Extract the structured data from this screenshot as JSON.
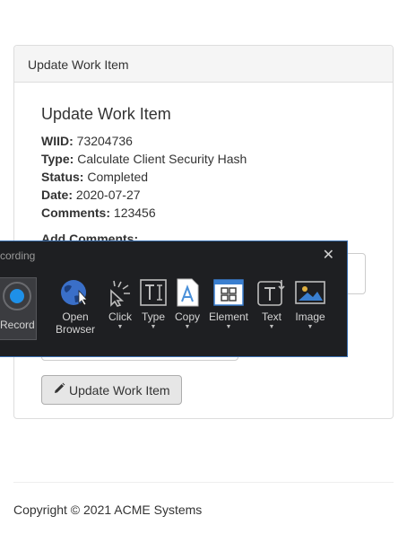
{
  "panel": {
    "heading": "Update Work Item"
  },
  "work_item": {
    "title": "Update Work Item",
    "fields": [
      {
        "label": "WIID:",
        "value": "73204736"
      },
      {
        "label": "Type:",
        "value": "Calculate Client Security Hash"
      },
      {
        "label": "Status:",
        "value": "Completed"
      },
      {
        "label": "Date:",
        "value": "2020-07-27"
      },
      {
        "label": "Comments:",
        "value": "123456"
      }
    ],
    "add_comments_label": "Add Comments:",
    "submit_label": "Update Work Item"
  },
  "recorder": {
    "title": "cording",
    "close": "✕",
    "record_label": "Record",
    "tools": [
      {
        "line1": "Open",
        "line2": "Browser",
        "icon": "globe-cursor-icon"
      },
      {
        "line1": "Click",
        "icon": "click-pointer-icon"
      },
      {
        "line1": "Type",
        "icon": "text-type-icon"
      },
      {
        "line1": "Copy",
        "icon": "copy-document-icon"
      },
      {
        "line1": "Element",
        "icon": "element-window-icon"
      },
      {
        "line1": "Text",
        "icon": "text-arrow-icon"
      },
      {
        "line1": "Image",
        "icon": "image-icon"
      }
    ]
  },
  "footer": {
    "copyright": "Copyright © 2021 ACME Systems"
  }
}
